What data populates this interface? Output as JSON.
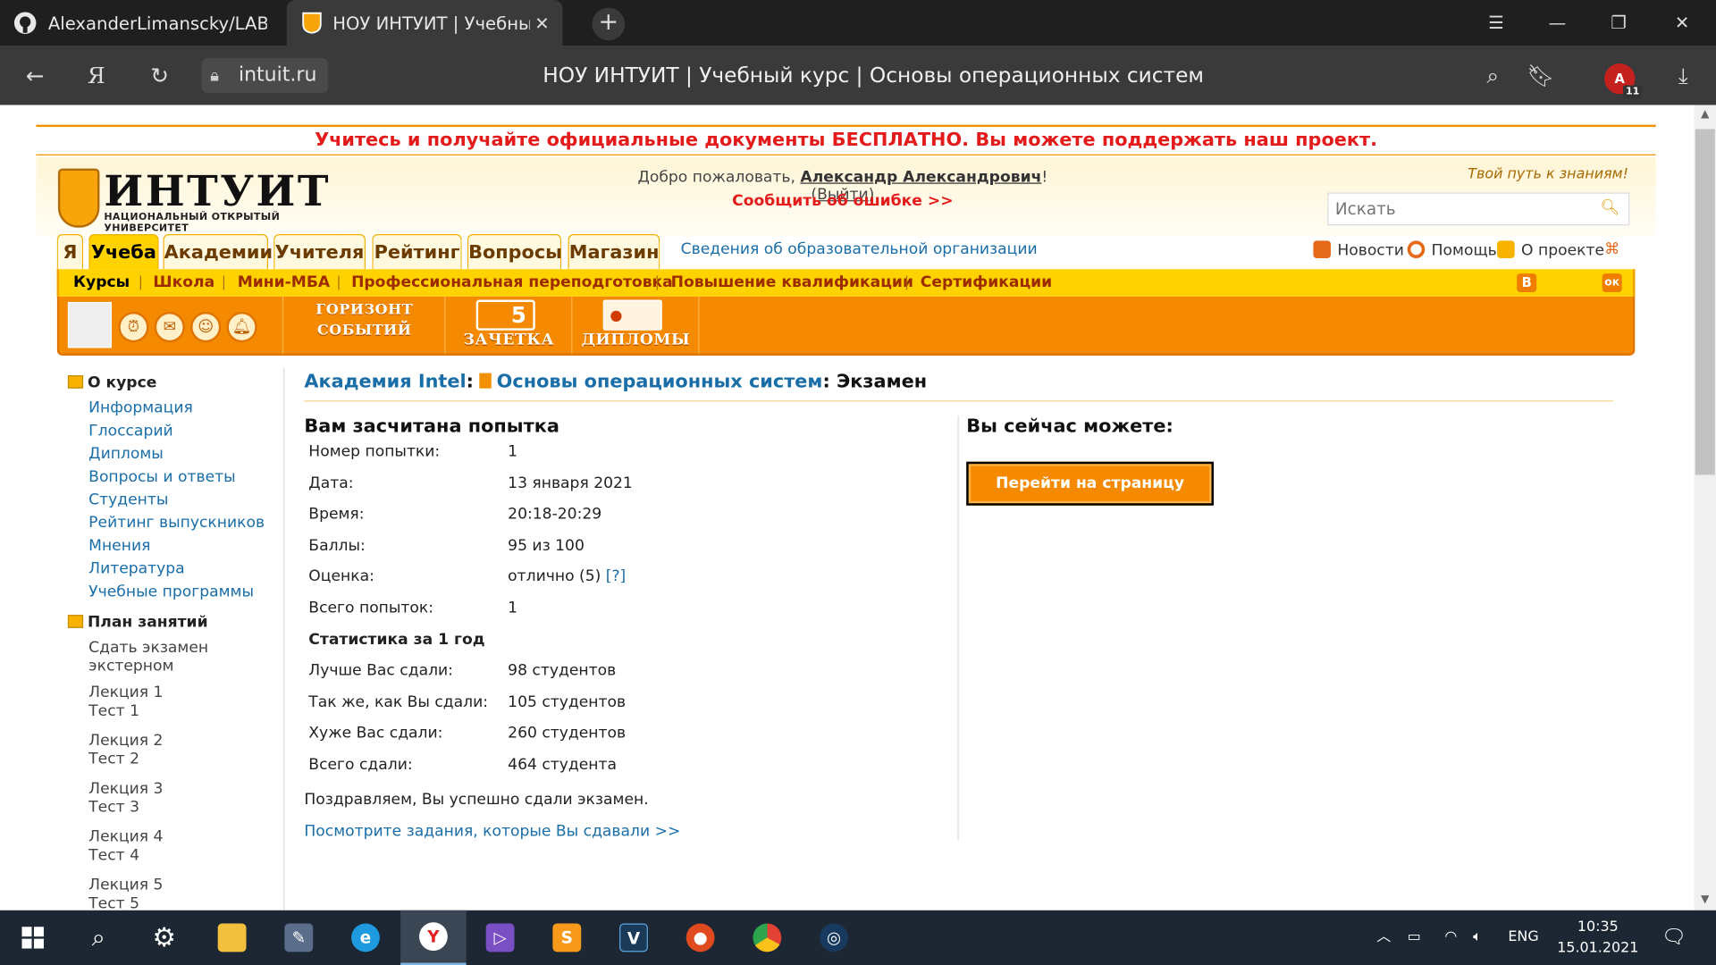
{
  "browser": {
    "tabs": [
      {
        "title": "AlexanderLimanscky/LABR"
      },
      {
        "title": "НОУ ИНТУИТ | Учебный"
      }
    ],
    "url": "intuit.ru",
    "page_title": "НОУ ИНТУИТ | Учебный курс | Основы операционных систем",
    "notif_letter": "A",
    "notif_count": "11"
  },
  "site": {
    "promo": "Учитесь и получайте официальные документы БЕСПЛАТНО. Вы можете поддержать наш проект.",
    "logo_name": "ИНТУИТ",
    "logo_sub": "НАЦИОНАЛЬНЫЙ ОТКРЫТЫЙ УНИВЕРСИТЕТ",
    "welcome_prefix": "Добро пожаловать, ",
    "user_name": "Александр Александрович",
    "welcome_excl": "! (",
    "logout": "Выйти",
    "welcome_close": ")",
    "report_error": "Сообщить об ошибке >>",
    "slogan": "Твой путь к знаниям!",
    "search_placeholder": "Искать",
    "main_tabs": [
      "Я",
      "Учеба",
      "Академии",
      "Учителя",
      "Рейтинг",
      "Вопросы",
      "Магазин"
    ],
    "org_info": "Сведения об образовательной организации",
    "top_links": [
      "Новости",
      "Помощь",
      "О проекте"
    ],
    "sub_nav": [
      "Курсы",
      "Школа",
      "Мини-МБА",
      "Профессиональная переподготовка",
      "Повышение квалификации",
      "Сертификации"
    ],
    "social": [
      "В",
      "ок"
    ],
    "orange_labels": {
      "horizon_line1": "ГОРИЗОНТ",
      "horizon_line2": "СОБЫТИЙ",
      "gradebook": "ЗАЧЕТКА",
      "gradebook_num": "5",
      "diplomas": "ДИПЛОМЫ"
    }
  },
  "sidebar": {
    "about_title": "О курсе",
    "about_links": [
      "Информация",
      "Глоссарий",
      "Дипломы",
      "Вопросы и ответы",
      "Студенты",
      "Рейтинг выпускников",
      "Мнения",
      "Литература",
      "Учебные программы"
    ],
    "plan_title": "План занятий",
    "plan_items": [
      {
        "l1": "Сдать экзамен",
        "l2": "экстерном"
      },
      {
        "l1": "Лекция 1",
        "l2": "Тест 1"
      },
      {
        "l1": "Лекция 2",
        "l2": "Тест 2"
      },
      {
        "l1": "Лекция 3",
        "l2": "Тест 3"
      },
      {
        "l1": "Лекция 4",
        "l2": "Тест 4"
      },
      {
        "l1": "Лекция 5",
        "l2": "Тест 5"
      }
    ]
  },
  "main": {
    "breadcrumb": {
      "academy": "Академия Intel",
      "course": "Основы операционных систем",
      "page": "Экзамен"
    },
    "attempt_title": "Вам засчитана попытка",
    "rows": [
      {
        "k": "Номер попытки:",
        "v": "1"
      },
      {
        "k": "Дата:",
        "v": "13 января 2021"
      },
      {
        "k": "Время:",
        "v": "20:18-20:29"
      },
      {
        "k": "Баллы:",
        "v": "95 из 100"
      },
      {
        "k": "Оценка:",
        "v": "отлично (5)",
        "help": "[?]"
      },
      {
        "k": "Всего попыток:",
        "v": "1"
      }
    ],
    "stats_title": "Статистика за 1 год",
    "stats": [
      {
        "k": "Лучше Вас сдали:",
        "v": "98 студентов"
      },
      {
        "k": "Так же, как Вы сдали:",
        "v": "105 студентов"
      },
      {
        "k": "Хуже Вас сдали:",
        "v": "260 студентов"
      },
      {
        "k": "Всего сдали:",
        "v": "464 студента"
      }
    ],
    "congrats": "Поздравляем, Вы успешно сдали экзамен.",
    "tasks_link": "Посмотрите задания, которые Вы сдавали >>",
    "can_title": "Вы сейчас можете:",
    "go_course": "Перейти на страницу курса"
  },
  "taskbar": {
    "lang": "ENG",
    "time": "10:35",
    "date": "15.01.2021"
  },
  "colors": {
    "accent_orange": "#f58a00",
    "accent_yellow": "#ffd200",
    "link": "#1a6ea8",
    "promo_red": "#e31b1b"
  }
}
